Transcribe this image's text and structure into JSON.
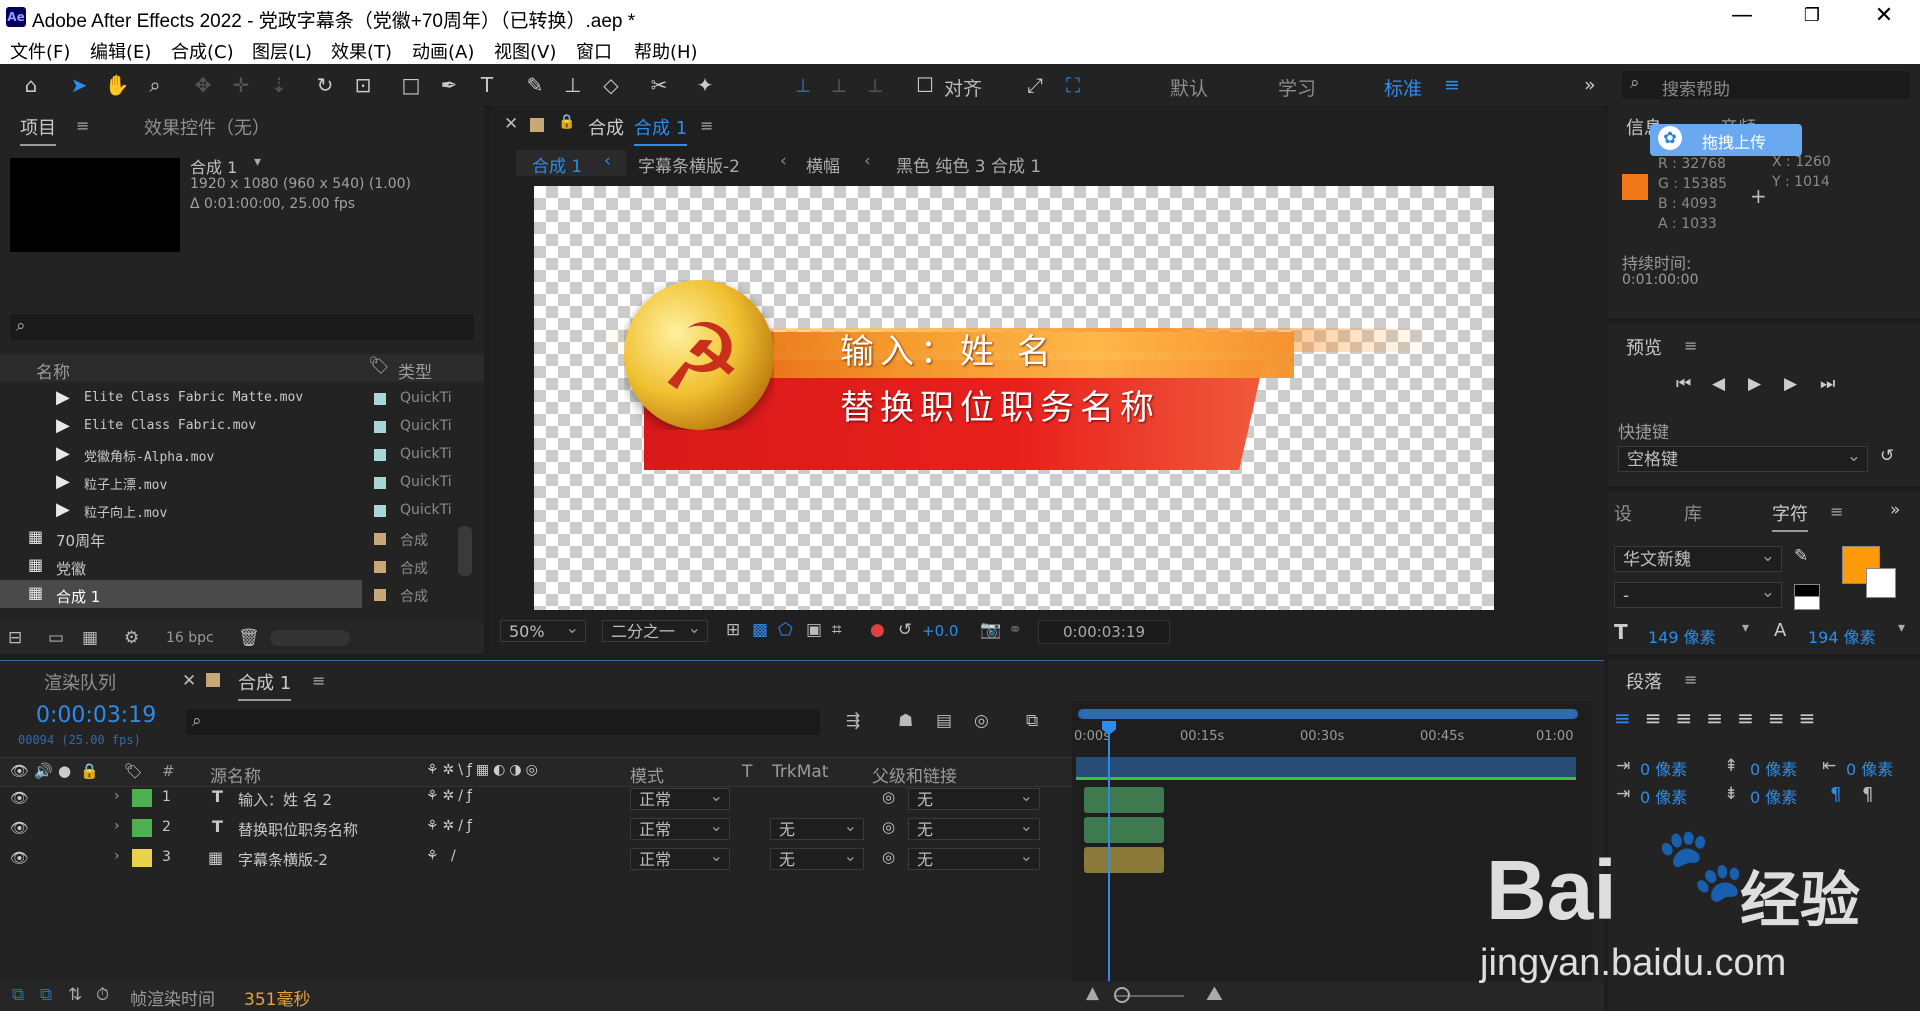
{
  "window": {
    "title": "Adobe After Effects 2022 - 党政字幕条（党徽+70周年）（已转换）.aep *",
    "logo": "Ae"
  },
  "menu": [
    "文件(F)",
    "编辑(E)",
    "合成(C)",
    "图层(L)",
    "效果(T)",
    "动画(A)",
    "视图(V)",
    "窗口",
    "帮助(H)"
  ],
  "toolbar": {
    "align_label": "对齐",
    "workspaces": [
      "默认",
      "学习",
      "标准"
    ],
    "search_placeholder": "搜索帮助"
  },
  "project_panel": {
    "tab_project": "项目",
    "tab_effects": "效果控件（无）",
    "comp_name": "合成 1",
    "comp_info_1": "1920 x 1080  (960 x 540) (1.00)",
    "comp_info_2": "Δ 0:01:00:00, 25.00 fps",
    "col_name": "名称",
    "col_type": "类型",
    "items": [
      {
        "name": "Elite Class Fabric Matte.mov",
        "type": "QuickTi",
        "swatch": "#a8d6d6"
      },
      {
        "name": "Elite Class Fabric.mov",
        "type": "QuickTi",
        "swatch": "#a8d6d6"
      },
      {
        "name": "党徽角标-Alpha.mov",
        "type": "QuickTi",
        "swatch": "#a8d6d6"
      },
      {
        "name": "粒子上漂.mov",
        "type": "QuickTi",
        "swatch": "#a8d6d6"
      },
      {
        "name": "粒子向上.mov",
        "type": "QuickTi",
        "swatch": "#a8d6d6"
      },
      {
        "name": "70周年",
        "type": "合成",
        "swatch": "#c8a878"
      },
      {
        "name": "党徽",
        "type": "合成",
        "swatch": "#c8a878"
      },
      {
        "name": "合成 1",
        "type": "合成",
        "swatch": "#c8a878"
      }
    ],
    "bpc": "16 bpc"
  },
  "composition_panel": {
    "tab_label": "合成",
    "tab_comp": "合成 1",
    "breadcrumbs": [
      "合成 1",
      "字幕条横版-2",
      "横幅",
      "黑色 纯色 3 合成 1"
    ],
    "title_line": "输入：姓  名",
    "subtitle_line": "替换职位职务名称",
    "zoom": "50%",
    "resolution": "二分之一",
    "exposure": "+0.0",
    "timecode": "0:00:03:19"
  },
  "info_panel": {
    "tab_info": "信息",
    "tab_audio": "音频",
    "upload_label": "拖拽上传",
    "r": "R : 32768",
    "g": "G : 15385",
    "b": "B : 4093",
    "a": "A : 1033",
    "x": "X : 1260",
    "y": "Y : 1014",
    "duration_label": "持续时间:",
    "duration_value": "0:01:00:00",
    "color": "#f07818"
  },
  "preview_panel": {
    "title": "预览",
    "shortcut_label": "快捷键",
    "shortcut_value": "空格键"
  },
  "character_panel": {
    "tab_settings": "设",
    "tab_library": "库",
    "tab_character": "字符",
    "font": "华文新魏",
    "style": "-",
    "size": "149 像素",
    "leading": "194 像素",
    "fill_color": "#ff9a0a"
  },
  "paragraph_panel": {
    "title": "段落",
    "indent_left": "0 像素",
    "space_before": "0 像素",
    "indent_right": "0 像素",
    "indent_first": "0 像素",
    "space_after": "0 像素"
  },
  "timeline": {
    "tab_render": "渲染队列",
    "tab_comp": "合成 1",
    "timecode": "0:00:03:19",
    "frame_info": "00094 (25.00 fps)",
    "col_source": "源名称",
    "col_mode": "模式",
    "col_t": "T",
    "col_trkmat": "TrkMat",
    "col_parent": "父级和链接",
    "ruler": [
      "0:00s",
      "00:15s",
      "00:30s",
      "00:45s",
      "01:00"
    ],
    "layers": [
      {
        "num": "1",
        "kind": "T",
        "name": "输入：姓 名 2",
        "mode": "正常",
        "trkmat": "",
        "parent": "无",
        "label": "#4caf50",
        "bar": "#3e7a4e"
      },
      {
        "num": "2",
        "kind": "T",
        "name": "替换职位职务名称",
        "mode": "正常",
        "trkmat": "无",
        "parent": "无",
        "label": "#4caf50",
        "bar": "#3e7a4e"
      },
      {
        "num": "3",
        "kind": "comp",
        "name": "字幕条横版-2",
        "mode": "正常",
        "trkmat": "无",
        "parent": "无",
        "label": "#e8d34a",
        "bar": "#8a7a3a"
      }
    ],
    "render_time_label": "帧渲染时间",
    "render_time_value": "351毫秒",
    "playhead_fraction": 0.064
  },
  "watermark": {
    "brand": "Bai",
    "brand_cn": "经验",
    "url": "jingyan.baidu.com"
  }
}
